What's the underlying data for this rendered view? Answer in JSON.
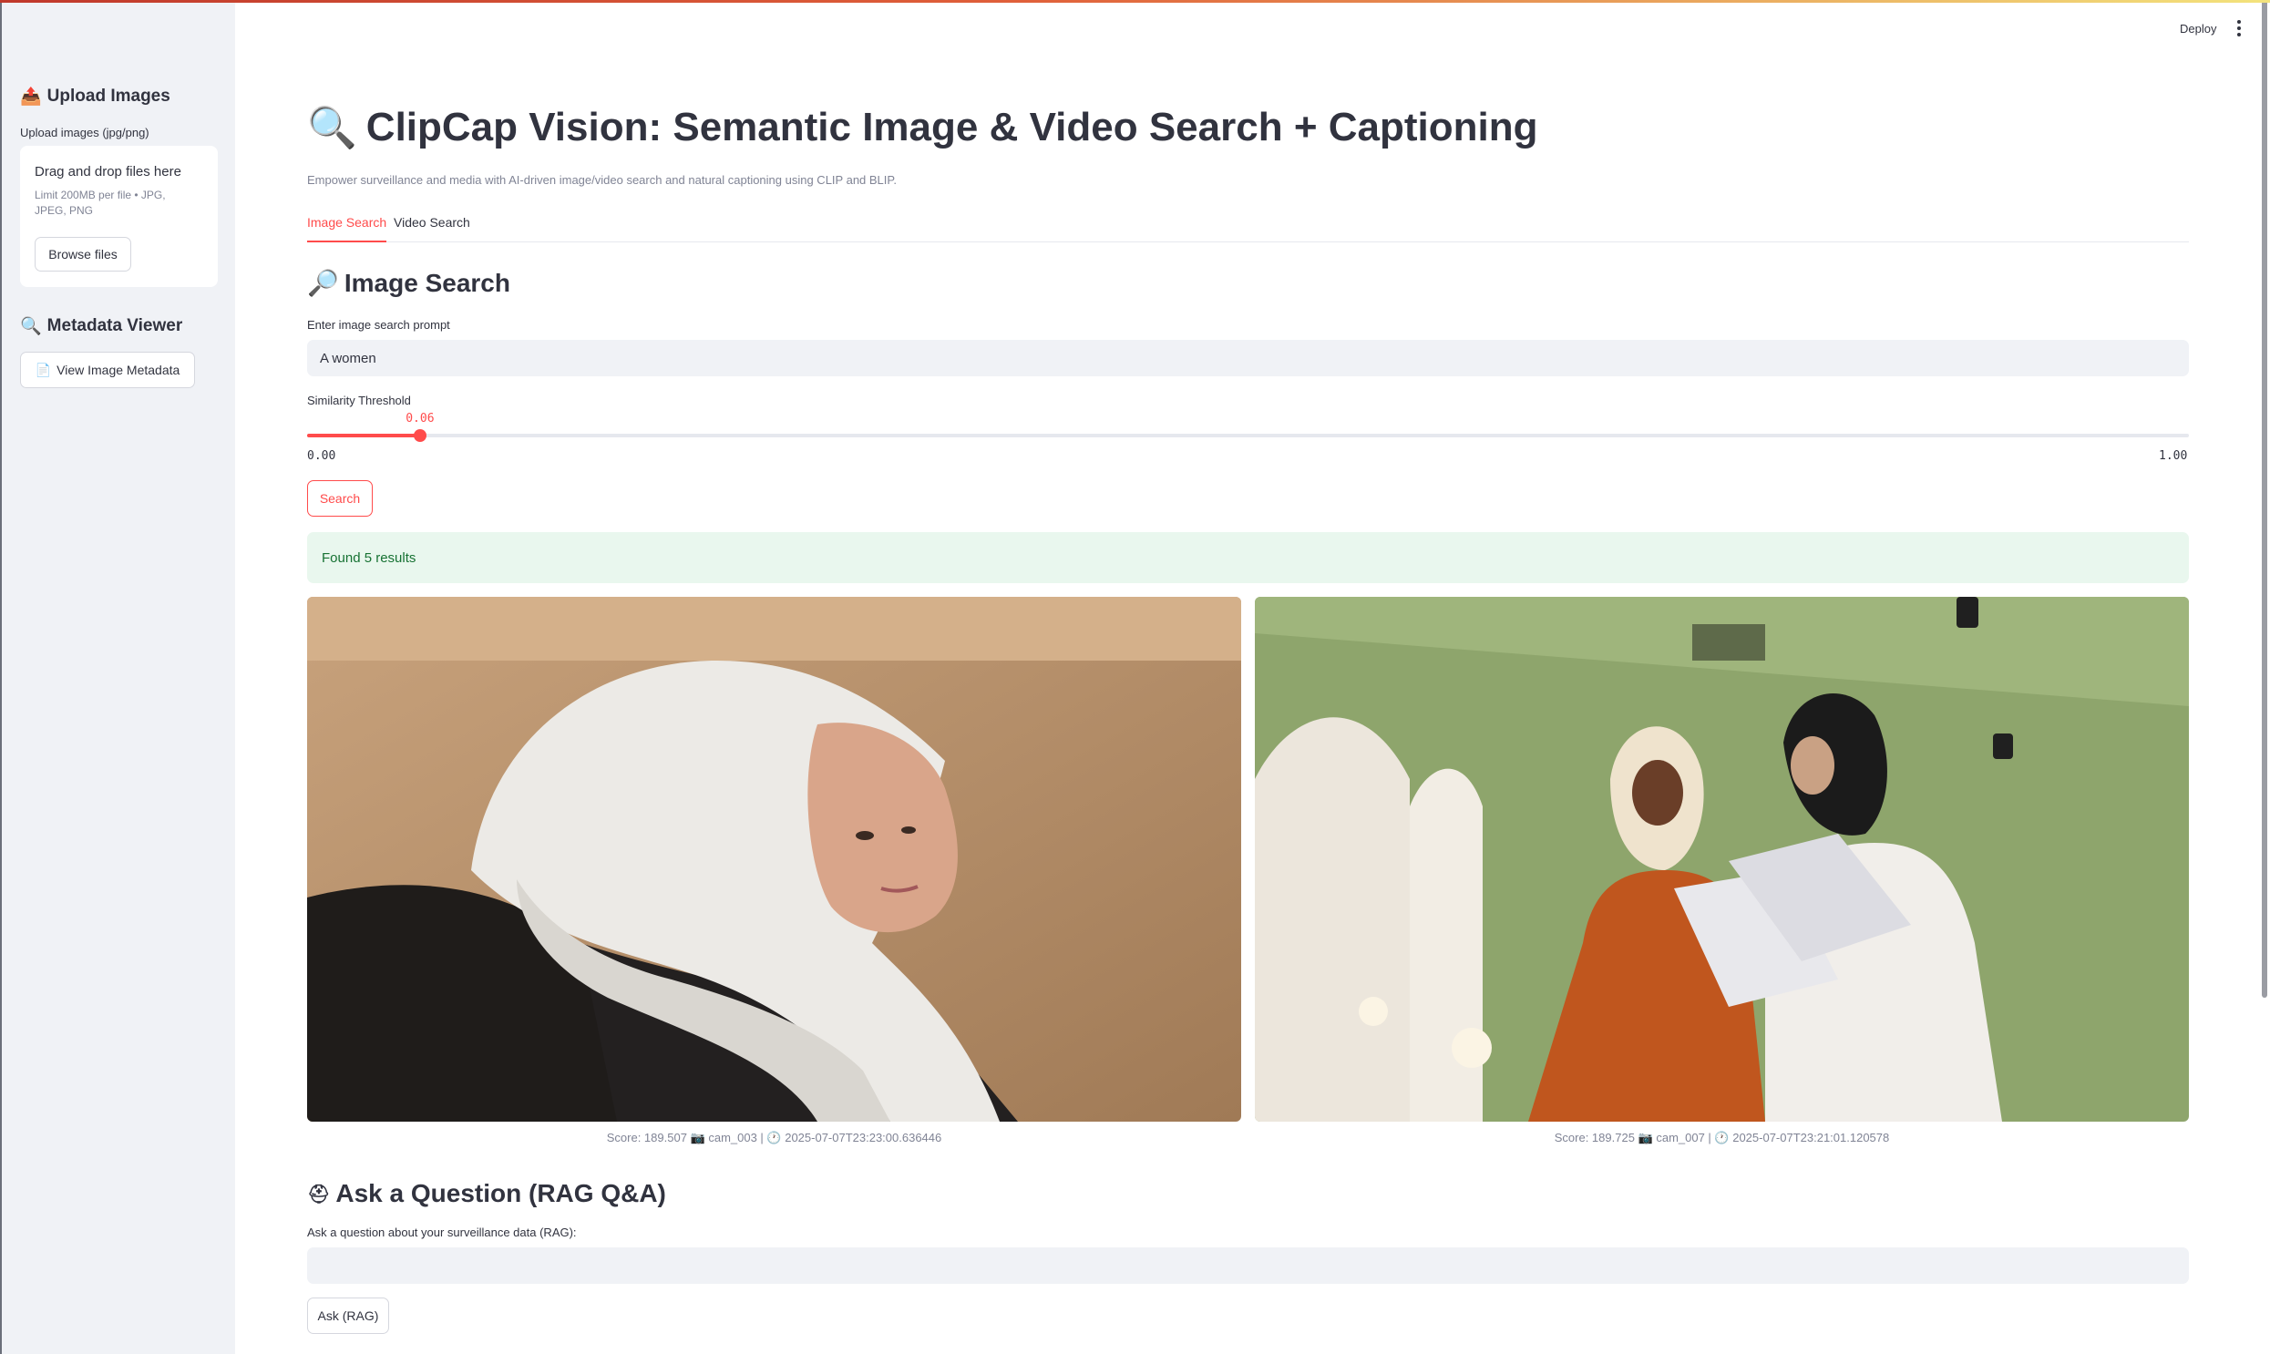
{
  "header": {
    "deploy_label": "Deploy"
  },
  "sidebar": {
    "upload_heading": "Upload Images",
    "upload_icon": "📤",
    "upload_label": "Upload images (jpg/png)",
    "dropzone_title": "Drag and drop files here",
    "dropzone_limit": "Limit 200MB per file • JPG, JPEG, PNG",
    "browse_label": "Browse files",
    "metadata_heading": "Metadata Viewer",
    "metadata_icon": "🔍",
    "view_metadata_icon": "📄",
    "view_metadata_label": "View Image Metadata"
  },
  "main": {
    "title_icon": "🔍",
    "title": "ClipCap Vision: Semantic Image & Video Search + Captioning",
    "subtitle": "Empower surveillance and media with AI-driven image/video search and natural captioning using CLIP and BLIP.",
    "tabs": [
      {
        "label": "Image Search",
        "active": true
      },
      {
        "label": "Video Search",
        "active": false
      }
    ],
    "image_search": {
      "heading_icon": "🔎",
      "heading": "Image Search",
      "prompt_label": "Enter image search prompt",
      "prompt_value": "A women",
      "threshold_label": "Similarity Threshold",
      "threshold_value": 0.06,
      "threshold_display": "0.06",
      "threshold_min": "0.00",
      "threshold_max": "1.00",
      "search_label": "Search",
      "result_message": "Found 5 results"
    },
    "results": [
      {
        "caption": "Score: 189.507 📷 cam_003 | 🕐 2025-07-07T23:23:00.636446"
      },
      {
        "caption": "Score: 189.725 📷 cam_007 | 🕐 2025-07-07T23:21:01.120578"
      }
    ],
    "rag": {
      "heading_icon": "⛑",
      "heading": "Ask a Question (RAG Q&A)",
      "question_label": "Ask a question about your surveillance data (RAG):",
      "question_value": "",
      "ask_label": "Ask (RAG)"
    }
  },
  "colors": {
    "accent": "#ff4b4b",
    "sidebar_bg": "#f0f2f6",
    "success_bg": "#e9f7ee",
    "success_text": "#177233"
  }
}
